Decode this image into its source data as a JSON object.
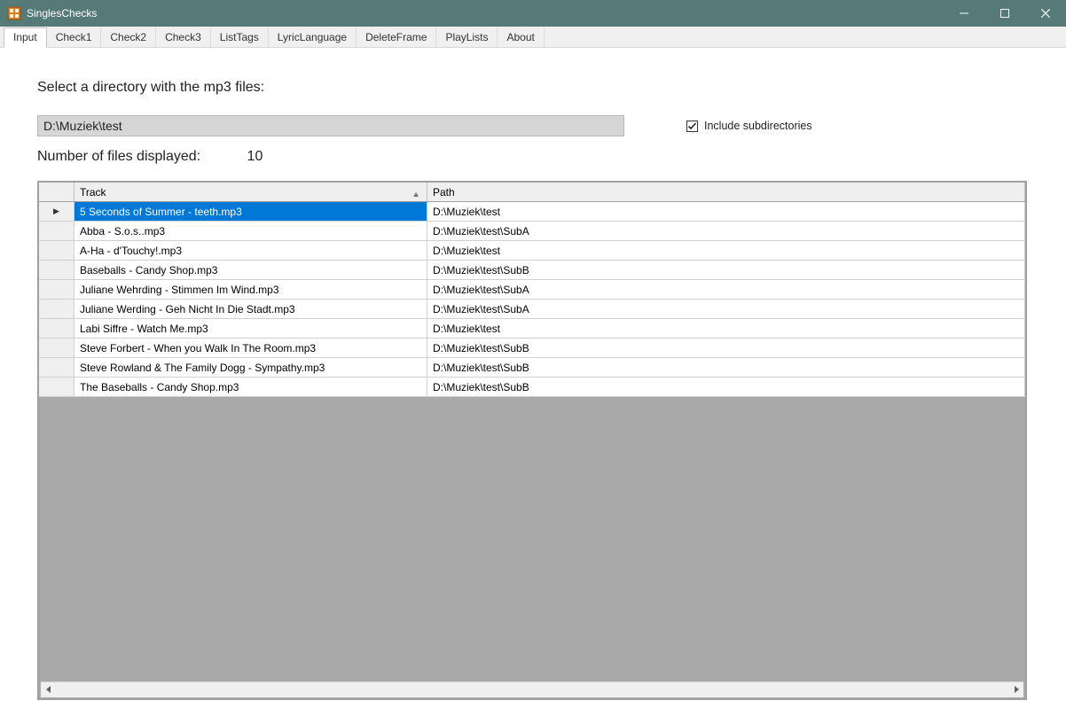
{
  "window": {
    "title": "SinglesChecks"
  },
  "tabs": [
    {
      "label": "Input",
      "active": true
    },
    {
      "label": "Check1",
      "active": false
    },
    {
      "label": "Check2",
      "active": false
    },
    {
      "label": "Check3",
      "active": false
    },
    {
      "label": "ListTags",
      "active": false
    },
    {
      "label": "LyricLanguage",
      "active": false
    },
    {
      "label": "DeleteFrame",
      "active": false
    },
    {
      "label": "PlayLists",
      "active": false
    },
    {
      "label": "About",
      "active": false
    }
  ],
  "input_page": {
    "prompt": "Select a directory with the mp3 files:",
    "directory_value": "D:\\Muziek\\test",
    "include_subdirs_label": "Include subdirectories",
    "include_subdirs_checked": true,
    "count_label": "Number of files displayed:",
    "count_value": "10"
  },
  "grid": {
    "columns": {
      "track": "Track",
      "path": "Path"
    },
    "sort_column": "track",
    "sort_dir": "asc",
    "rows": [
      {
        "track": "5 Seconds of Summer - teeth.mp3",
        "path": "D:\\Muziek\\test",
        "selected": true
      },
      {
        "track": "Abba - S.o.s..mp3",
        "path": "D:\\Muziek\\test\\SubA",
        "selected": false
      },
      {
        "track": "A-Ha - d'Touchy!.mp3",
        "path": "D:\\Muziek\\test",
        "selected": false
      },
      {
        "track": "Baseballs - Candy Shop.mp3",
        "path": "D:\\Muziek\\test\\SubB",
        "selected": false
      },
      {
        "track": "Juliane Wehrding - Stimmen Im Wind.mp3",
        "path": "D:\\Muziek\\test\\SubA",
        "selected": false
      },
      {
        "track": "Juliane Werding - Geh Nicht In Die Stadt.mp3",
        "path": "D:\\Muziek\\test\\SubA",
        "selected": false
      },
      {
        "track": "Labi Siffre - Watch Me.mp3",
        "path": "D:\\Muziek\\test",
        "selected": false
      },
      {
        "track": "Steve Forbert - When you Walk In The Room.mp3",
        "path": "D:\\Muziek\\test\\SubB",
        "selected": false
      },
      {
        "track": "Steve Rowland & The Family Dogg - Sympathy.mp3",
        "path": "D:\\Muziek\\test\\SubB",
        "selected": false
      },
      {
        "track": "The Baseballs - Candy Shop.mp3",
        "path": "D:\\Muziek\\test\\SubB",
        "selected": false
      }
    ]
  }
}
